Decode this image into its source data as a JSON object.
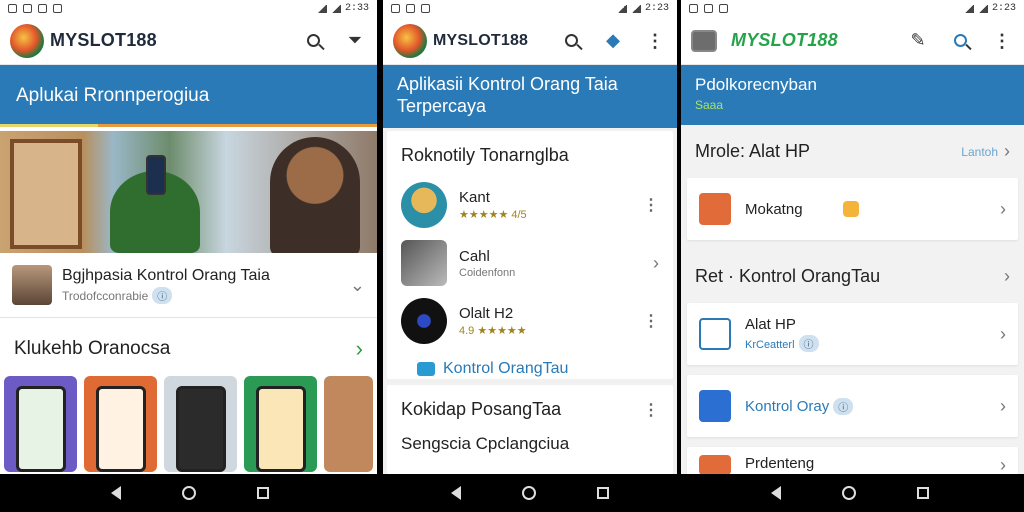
{
  "status": {
    "time_1": "2:33",
    "time_2": "2:23",
    "time_3": "2:23"
  },
  "p1": {
    "brand": "MYSLOT188",
    "banner": "Aplukai Rronnperogiua",
    "featured": {
      "title": "Bgjhpasia Kontrol Orang Taia",
      "sub": "Trodofcconrabie"
    },
    "section_title": "Klukehb Oranocsa"
  },
  "p2": {
    "brand": "MYSLOT188",
    "banner_line1": "Aplikasii Kontrol Orang Taia",
    "banner_line2": "Terpercaya",
    "card1_title": "Roknotily Tonarnglba",
    "items": [
      {
        "title": "Kant",
        "sub": "★★★★★ 4/5"
      },
      {
        "title": "Cahl",
        "sub": "Coidenfonn"
      },
      {
        "title": "Olalt H2",
        "sub": "4.9 ★★★★★"
      }
    ],
    "link": "Kontrol OrangTau",
    "card2_title": "Kokidap PosangTaa",
    "card2_sub": "Sengscia Cpclangciua"
  },
  "p3": {
    "brand": "MYSLOT188",
    "banner": "Pdolkorecnyban",
    "banner_sub": "Saaa",
    "section1": "Mrole: Alat HP",
    "section1_more": "Lantoh",
    "row1": "Mokatng",
    "section2": "Ret · Kontrol OrangTau",
    "row2_title": "Alat HP",
    "row2_sub": "KrCeatterl",
    "row3_title": "Kontrol Oray",
    "row4_title": "Prdenteng"
  },
  "colors": {
    "accent": "#2a7ab8",
    "brand_green": "#25a34a"
  }
}
